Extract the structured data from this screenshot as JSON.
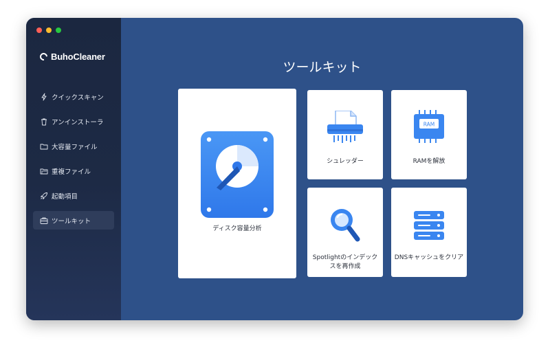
{
  "app": {
    "name": "BuhoCleaner"
  },
  "sidebar": {
    "items": [
      {
        "label": "クイックスキャン",
        "icon": "lightning-icon"
      },
      {
        "label": "アンインストーラ",
        "icon": "trash-icon"
      },
      {
        "label": "大容量ファイル",
        "icon": "folder-icon"
      },
      {
        "label": "重複ファイル",
        "icon": "duplicate-folder-icon"
      },
      {
        "label": "起動項目",
        "icon": "rocket-icon"
      },
      {
        "label": "ツールキット",
        "icon": "toolkit-icon",
        "active": true
      }
    ]
  },
  "main": {
    "title": "ツールキット",
    "tools": [
      {
        "label": "ディスク容量分析",
        "icon": "disk-analyzer-icon"
      },
      {
        "label": "シュレッダー",
        "icon": "shredder-icon"
      },
      {
        "label": "RAMを解放",
        "icon": "ram-icon",
        "chip_text": "RAM"
      },
      {
        "label": "Spotlightのインデックスを再作成",
        "icon": "magnifier-icon"
      },
      {
        "label": "DNSキャッシュをクリア",
        "icon": "server-icon"
      }
    ]
  },
  "colors": {
    "accent": "#2e5189",
    "sidebar": "#1d2a45",
    "icon_blue": "#3a86f0"
  }
}
